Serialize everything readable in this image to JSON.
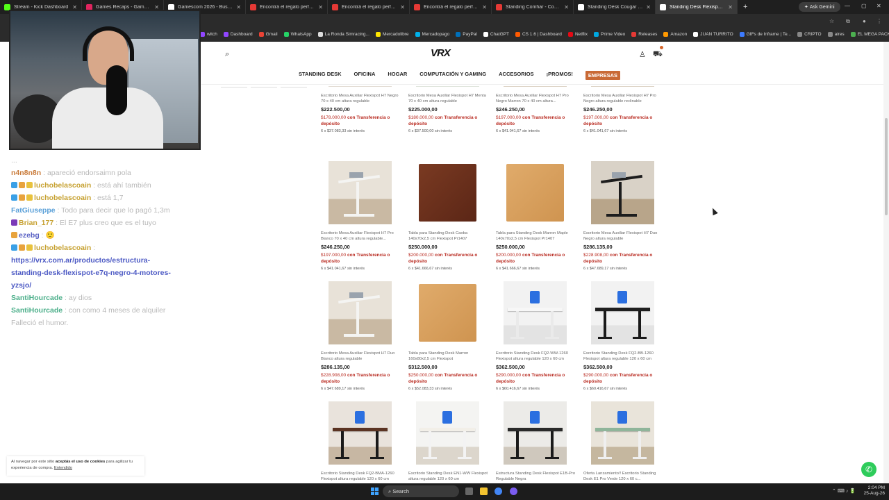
{
  "browser": {
    "tabs": [
      {
        "title": "Stream - Kick Dashboard",
        "color": "#53fc18"
      },
      {
        "title": "Games Recaps - Game Trailers",
        "color": "#e0245e"
      },
      {
        "title": "Gamescom 2026 - Buscar con G",
        "color": "#ffffff"
      },
      {
        "title": "Encontrá el regalo perfecto!",
        "color": "#e53935"
      },
      {
        "title": "Encontrá el regalo perfecto!",
        "color": "#e53935"
      },
      {
        "title": "Encontrá el regalo perfecto!",
        "color": "#e53935"
      },
      {
        "title": "Standing Comhar - Comprar en",
        "color": "#e53935"
      },
      {
        "title": "Standing Desk Cougar | Merca",
        "color": "#ffffff"
      },
      {
        "title": "Standing Desk Flexispot: Escrit",
        "color": "#ffffff"
      }
    ],
    "ask_gemini": "Ask Gemini",
    "bookmarks": [
      {
        "label": "witch",
        "color": "#9146ff"
      },
      {
        "label": "Dashboard",
        "color": "#9146ff"
      },
      {
        "label": "Gmail",
        "color": "#ea4335"
      },
      {
        "label": "WhatsApp",
        "color": "#25d366"
      },
      {
        "label": "La Ronda Simracing...",
        "color": "#dddddd"
      },
      {
        "label": "Mercadolibre",
        "color": "#ffe600"
      },
      {
        "label": "Mercadopago",
        "color": "#00b1ea"
      },
      {
        "label": "PayPal",
        "color": "#0070ba"
      },
      {
        "label": "ChatGPT",
        "color": "#ffffff"
      },
      {
        "label": "CS 1.6 | Dashboard",
        "color": "#ff5a00"
      },
      {
        "label": "Netflix",
        "color": "#e50914"
      },
      {
        "label": "Prime Video",
        "color": "#00a8e1"
      },
      {
        "label": "Releases",
        "color": "#e53935"
      },
      {
        "label": "Amazon",
        "color": "#ff9900"
      },
      {
        "label": "JUAN TURRITO",
        "color": "#ffffff"
      },
      {
        "label": "GIFs de Inframe | Te...",
        "color": "#3d7bff"
      },
      {
        "label": "CRIPTO",
        "color": "#888888"
      },
      {
        "label": "aires",
        "color": "#888888"
      },
      {
        "label": "EL MEGA PACK PAP...",
        "color": "#4caf50"
      }
    ]
  },
  "chat": [
    {
      "user": "",
      "user_color": "#b9b9b9",
      "text": "...",
      "badges": []
    },
    {
      "user": "n4n8n8n",
      "user_color": "#c97b3a",
      "text": "apareció endorsaimn pola",
      "badges": []
    },
    {
      "user": "luchobelascoain",
      "user_color": "#c7a233",
      "text": "está ahí también",
      "badges": [
        "#3aa0e6",
        "#e8a33d",
        "#e8c23d"
      ]
    },
    {
      "user": "luchobelascoain",
      "user_color": "#c7a233",
      "text": "está 1,7",
      "badges": [
        "#3aa0e6",
        "#e8a33d",
        "#e8c23d"
      ]
    },
    {
      "user": "FatGiuseppe",
      "user_color": "#5aa0d8",
      "text": "Todo para decir que lo pagó 1,3m",
      "badges": []
    },
    {
      "user": "Brian_177",
      "user_color": "#c7a233",
      "text": "El E7 plus creo que es el tuyo",
      "badges": [
        "#7b3ab8"
      ]
    },
    {
      "user": "ezebg",
      "user_color": "#5a62c4",
      "text": "🙂",
      "badges": [
        "#e8a33d"
      ]
    },
    {
      "user": "luchobelascoain",
      "user_color": "#c7a233",
      "text": "",
      "badges": [
        "#3aa0e6",
        "#e8a33d",
        "#e8c23d"
      ]
    },
    {
      "user": "",
      "user_color": "#4d5ac4",
      "text": "https://vrx.com.ar/productos/estructura-standing-desk-flexispot-e7q-negro-4-motores-yzsjo/",
      "badges": [],
      "is_link": true
    },
    {
      "user": "SantiHourcade",
      "user_color": "#4caf8a",
      "text": "ay dios",
      "badges": []
    },
    {
      "user": "SantiHourcade",
      "user_color": "#4caf8a",
      "text": "con como 4 meses de alquiler",
      "badges": []
    },
    {
      "user": "",
      "user_color": "#b9b9b9",
      "text": "Falleció el humor.",
      "badges": []
    }
  ],
  "site": {
    "logo": "VRX",
    "nav": [
      "STANDING DESK",
      "OFICINA",
      "HOGAR",
      "COMPUTACIÓN Y GAMING",
      "ACCESORIOS",
      "¡PROMOS!",
      "EMPRESAS"
    ],
    "transfer_suffix": "con Transferencia o depósito",
    "installment_suffix": "sin interés",
    "products": [
      {
        "name": "Escritorio Mesa Auxiliar Flexispot H7 Negro 70 x 40 cm altura regulable",
        "price": "$222.500,00",
        "transfer": "$178.000,00",
        "inst": "6 x $37.083,33",
        "img": "table-black"
      },
      {
        "name": "Escritorio Mesa Auxiliar Flexispot H7 Menta 70 x 40 cm altura regulable",
        "price": "$225.000,00",
        "transfer": "$180.000,00",
        "inst": "6 x $37.500,00",
        "img": "table-mint"
      },
      {
        "name": "Escritorio Mesa Auxiliar Flexispot H7 Pro Negro Marron 70 x 40 cm altura...",
        "price": "$246.250,00",
        "transfer": "$197.000,00",
        "inst": "6 x $41.041,67",
        "img": "table-brown"
      },
      {
        "name": "Escritorio Mesa Auxiliar Flexispot H7 Pro Negro altura regulable reclinable",
        "price": "$246.250,00",
        "transfer": "$197.000,00",
        "inst": "6 x $41.041,67",
        "img": "table-brown"
      },
      {
        "name": "Escritorio Mesa Auxiliar Flexispot H7 Pro Blanco 70 x 40 cm altura regulable...",
        "price": "$246.250,00",
        "transfer": "$197.000,00",
        "inst": "6 x $41.041,67",
        "img": "aux-white"
      },
      {
        "name": "Tabla para Standing Desk Caoba 140x70x2,5 cm Flexispot Pr1407",
        "price": "$250.000,00",
        "transfer": "$200.000,00",
        "inst": "6 x $41.666,67",
        "img": "board-caoba"
      },
      {
        "name": "Tabla para Standing Desk Marron Maple 140x70x2,5 cm Flexispot Pr1407",
        "price": "$250.000,00",
        "transfer": "$200.000,00",
        "inst": "6 x $41.666,67",
        "img": "board-maple"
      },
      {
        "name": "Escritorio Mesa Auxiliar Flexispot H7 Duo Negro altura regulable",
        "price": "$286.135,00",
        "transfer": "$228.908,00",
        "inst": "6 x $47.689,17",
        "img": "aux-black"
      },
      {
        "name": "Escritorio Mesa Auxiliar Flexispot H7 Duo Blanco altura regulable",
        "price": "$286.135,00",
        "transfer": "$228.908,00",
        "inst": "6 x $47.689,17",
        "img": "aux-white"
      },
      {
        "name": "Tabla para Standing Desk Marron 160x80x2,5 cm Flexispot",
        "price": "$312.500,00",
        "transfer": "$250.000,00",
        "inst": "6 x $52.083,33",
        "img": "board-maple"
      },
      {
        "name": "Escritorio Standing Desk FQ2-WW-1260 Flexispot altura regulable 120 x 60 cm",
        "price": "$362.500,00",
        "transfer": "$290.000,00",
        "inst": "6 x $60.416,67",
        "img": "desk-white"
      },
      {
        "name": "Escritorio Standing Desk FQ2-BB-1260 Flexispot altura regulable 120 x 60 cm",
        "price": "$362.500,00",
        "transfer": "$290.000,00",
        "inst": "6 x $60.416,67",
        "img": "desk-black"
      },
      {
        "name": "Escritorio Standing Desk FQ2-BMA-1260 Flexispot altura regulable 120 x 60 cm",
        "price": "",
        "transfer": "",
        "inst": "",
        "img": "desk-brown"
      },
      {
        "name": "Escritorio Standing Desk EN1-WW Flexispot altura regulable 120 x 60 cm",
        "price": "",
        "transfer": "",
        "inst": "",
        "img": "desk-white2"
      },
      {
        "name": "Estructura Standing Desk Flexispot E1B-Pro Regulable Negra",
        "price": "",
        "transfer": "",
        "inst": "",
        "img": "desk-black2"
      },
      {
        "name": "Oferta Lanzamiento!! Escritorio Standing Desk E1 Pro Verde 120 x 60 c...",
        "price": "",
        "transfer": "",
        "inst": "",
        "img": "desk-green"
      }
    ],
    "cookie": {
      "prefix": "Al navegar por este sitio",
      "bold": "aceptás el uso de cookies",
      "suffix": "para agilizar tu experiencia de compra.",
      "button": "Entendido"
    }
  },
  "taskbar": {
    "search_placeholder": "Search",
    "time": "2:04 PM",
    "date": "25-Aug-26"
  }
}
